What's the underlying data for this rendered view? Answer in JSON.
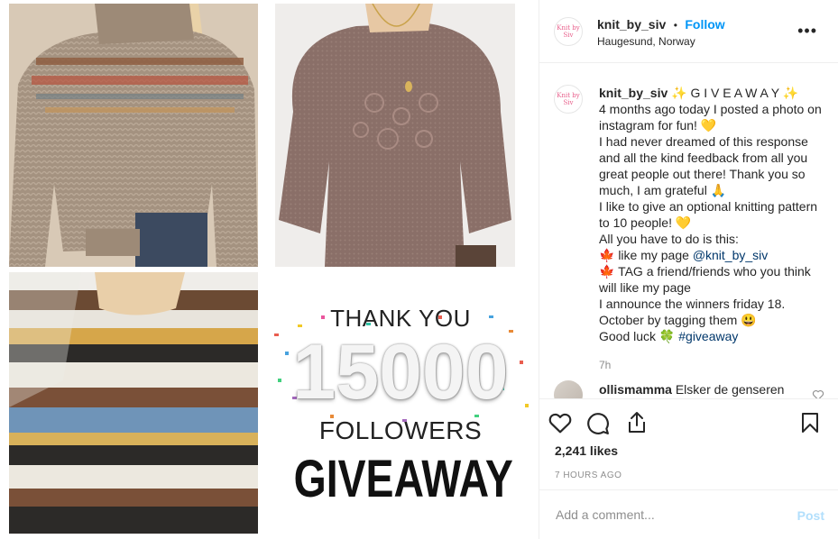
{
  "post": {
    "images": {
      "sweater_1": "knit-sweater-fairisle-yoke-icon",
      "sweater_2": "knit-sweater-floral-embroidered-icon",
      "sweater_3": "knit-sweater-striped-icon",
      "banner": {
        "line1": "THANK YOU",
        "number": "15000",
        "line2": "FOLLOWERS",
        "line3": "GIVEAWAY"
      }
    }
  },
  "header": {
    "avatar_text": "Knit by Siv",
    "username": "knit_by_siv",
    "separator": "•",
    "follow": "Follow",
    "location": "Haugesund, Norway",
    "more": "•••"
  },
  "caption": {
    "username": "knit_by_siv",
    "title": "✨ G I V E A W A Y ✨",
    "line1": "4 months ago today I posted a photo on instagram for fun! 💛",
    "line2": "I had never dreamed of this response and all the kind feedback from all you great people out there! Thank you so much, I am grateful 🙏",
    "line3": "I like to give an optional knitting pattern to 10 people! 💛",
    "line4": "All you have to do is this:",
    "line5_prefix": "🍁 like my page ",
    "line5_link": "@knit_by_siv",
    "line6": "🍁 TAG a friend/friends who you think will like my page",
    "line7": "I announce the winners friday 18. October by tagging them 😃",
    "line8_prefix": "Good luck 🍀 ",
    "line8_link": "#giveaway",
    "time": "7h"
  },
  "comment": {
    "username": "ollismamma",
    "text": "Elsker de genseren"
  },
  "actions": {
    "likes": "2,241 likes",
    "posted": "7 HOURS AGO",
    "placeholder": "Add a comment...",
    "post_label": "Post"
  },
  "colors": {
    "accent": "#0095f6",
    "text": "#262626",
    "muted": "#8e8e8e",
    "post_disabled": "#b2dffc"
  }
}
